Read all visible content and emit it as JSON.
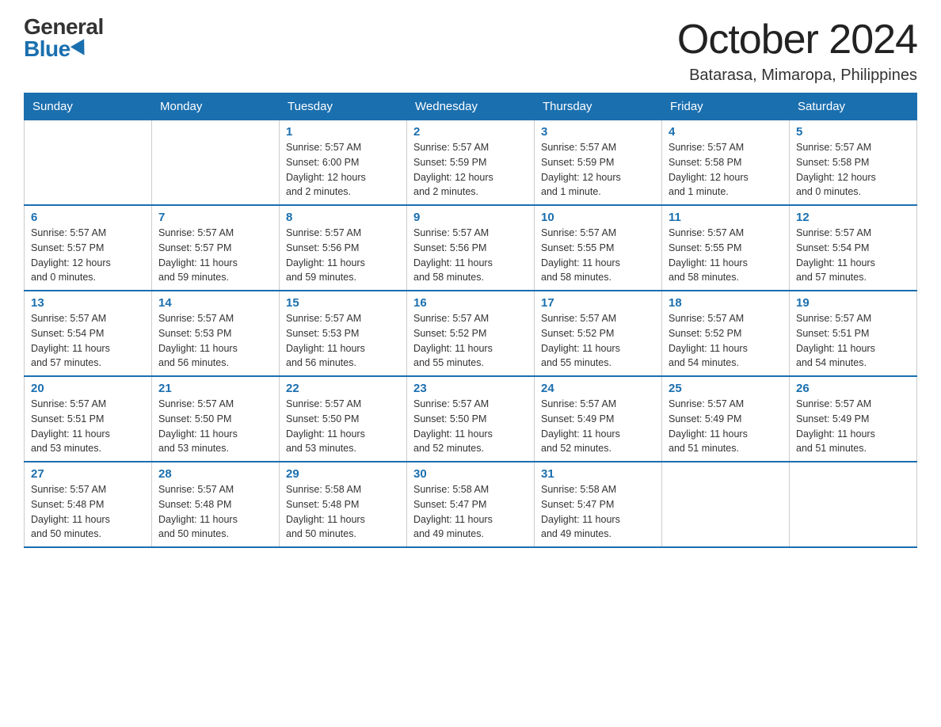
{
  "header": {
    "logo_general": "General",
    "logo_blue": "Blue",
    "month_title": "October 2024",
    "location": "Batarasa, Mimaropa, Philippines"
  },
  "weekdays": [
    "Sunday",
    "Monday",
    "Tuesday",
    "Wednesday",
    "Thursday",
    "Friday",
    "Saturday"
  ],
  "weeks": [
    [
      {
        "day": "",
        "info": ""
      },
      {
        "day": "",
        "info": ""
      },
      {
        "day": "1",
        "info": "Sunrise: 5:57 AM\nSunset: 6:00 PM\nDaylight: 12 hours\nand 2 minutes."
      },
      {
        "day": "2",
        "info": "Sunrise: 5:57 AM\nSunset: 5:59 PM\nDaylight: 12 hours\nand 2 minutes."
      },
      {
        "day": "3",
        "info": "Sunrise: 5:57 AM\nSunset: 5:59 PM\nDaylight: 12 hours\nand 1 minute."
      },
      {
        "day": "4",
        "info": "Sunrise: 5:57 AM\nSunset: 5:58 PM\nDaylight: 12 hours\nand 1 minute."
      },
      {
        "day": "5",
        "info": "Sunrise: 5:57 AM\nSunset: 5:58 PM\nDaylight: 12 hours\nand 0 minutes."
      }
    ],
    [
      {
        "day": "6",
        "info": "Sunrise: 5:57 AM\nSunset: 5:57 PM\nDaylight: 12 hours\nand 0 minutes."
      },
      {
        "day": "7",
        "info": "Sunrise: 5:57 AM\nSunset: 5:57 PM\nDaylight: 11 hours\nand 59 minutes."
      },
      {
        "day": "8",
        "info": "Sunrise: 5:57 AM\nSunset: 5:56 PM\nDaylight: 11 hours\nand 59 minutes."
      },
      {
        "day": "9",
        "info": "Sunrise: 5:57 AM\nSunset: 5:56 PM\nDaylight: 11 hours\nand 58 minutes."
      },
      {
        "day": "10",
        "info": "Sunrise: 5:57 AM\nSunset: 5:55 PM\nDaylight: 11 hours\nand 58 minutes."
      },
      {
        "day": "11",
        "info": "Sunrise: 5:57 AM\nSunset: 5:55 PM\nDaylight: 11 hours\nand 58 minutes."
      },
      {
        "day": "12",
        "info": "Sunrise: 5:57 AM\nSunset: 5:54 PM\nDaylight: 11 hours\nand 57 minutes."
      }
    ],
    [
      {
        "day": "13",
        "info": "Sunrise: 5:57 AM\nSunset: 5:54 PM\nDaylight: 11 hours\nand 57 minutes."
      },
      {
        "day": "14",
        "info": "Sunrise: 5:57 AM\nSunset: 5:53 PM\nDaylight: 11 hours\nand 56 minutes."
      },
      {
        "day": "15",
        "info": "Sunrise: 5:57 AM\nSunset: 5:53 PM\nDaylight: 11 hours\nand 56 minutes."
      },
      {
        "day": "16",
        "info": "Sunrise: 5:57 AM\nSunset: 5:52 PM\nDaylight: 11 hours\nand 55 minutes."
      },
      {
        "day": "17",
        "info": "Sunrise: 5:57 AM\nSunset: 5:52 PM\nDaylight: 11 hours\nand 55 minutes."
      },
      {
        "day": "18",
        "info": "Sunrise: 5:57 AM\nSunset: 5:52 PM\nDaylight: 11 hours\nand 54 minutes."
      },
      {
        "day": "19",
        "info": "Sunrise: 5:57 AM\nSunset: 5:51 PM\nDaylight: 11 hours\nand 54 minutes."
      }
    ],
    [
      {
        "day": "20",
        "info": "Sunrise: 5:57 AM\nSunset: 5:51 PM\nDaylight: 11 hours\nand 53 minutes."
      },
      {
        "day": "21",
        "info": "Sunrise: 5:57 AM\nSunset: 5:50 PM\nDaylight: 11 hours\nand 53 minutes."
      },
      {
        "day": "22",
        "info": "Sunrise: 5:57 AM\nSunset: 5:50 PM\nDaylight: 11 hours\nand 53 minutes."
      },
      {
        "day": "23",
        "info": "Sunrise: 5:57 AM\nSunset: 5:50 PM\nDaylight: 11 hours\nand 52 minutes."
      },
      {
        "day": "24",
        "info": "Sunrise: 5:57 AM\nSunset: 5:49 PM\nDaylight: 11 hours\nand 52 minutes."
      },
      {
        "day": "25",
        "info": "Sunrise: 5:57 AM\nSunset: 5:49 PM\nDaylight: 11 hours\nand 51 minutes."
      },
      {
        "day": "26",
        "info": "Sunrise: 5:57 AM\nSunset: 5:49 PM\nDaylight: 11 hours\nand 51 minutes."
      }
    ],
    [
      {
        "day": "27",
        "info": "Sunrise: 5:57 AM\nSunset: 5:48 PM\nDaylight: 11 hours\nand 50 minutes."
      },
      {
        "day": "28",
        "info": "Sunrise: 5:57 AM\nSunset: 5:48 PM\nDaylight: 11 hours\nand 50 minutes."
      },
      {
        "day": "29",
        "info": "Sunrise: 5:58 AM\nSunset: 5:48 PM\nDaylight: 11 hours\nand 50 minutes."
      },
      {
        "day": "30",
        "info": "Sunrise: 5:58 AM\nSunset: 5:47 PM\nDaylight: 11 hours\nand 49 minutes."
      },
      {
        "day": "31",
        "info": "Sunrise: 5:58 AM\nSunset: 5:47 PM\nDaylight: 11 hours\nand 49 minutes."
      },
      {
        "day": "",
        "info": ""
      },
      {
        "day": "",
        "info": ""
      }
    ]
  ]
}
